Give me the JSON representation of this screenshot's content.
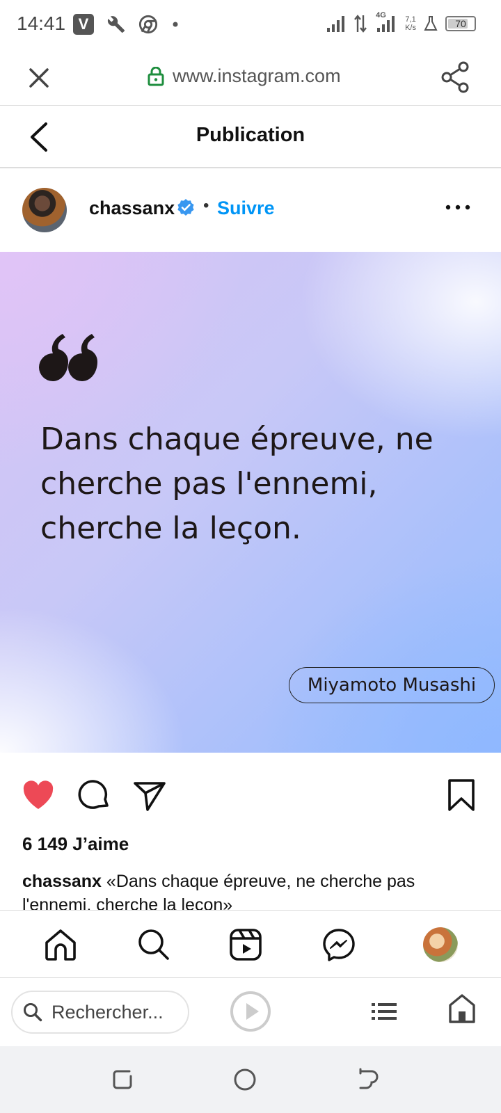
{
  "status_bar": {
    "time": "14:41",
    "network": "4G",
    "speed_value": "7,1",
    "speed_unit": "K/s",
    "battery": "70",
    "icons": [
      "v-app-icon",
      "wrench-icon",
      "chrome-icon",
      "dot-icon",
      "signal-icon",
      "data-arrows-icon",
      "signal-4g-icon",
      "beaker-icon",
      "battery-icon"
    ]
  },
  "browser": {
    "url": "www.instagram.com",
    "search_placeholder": "Rechercher..."
  },
  "header": {
    "title": "Publication"
  },
  "post": {
    "username": "chassanx",
    "follow_label": "Suivre",
    "separator": "•",
    "quote": "Dans chaque épreuve, ne cherche pas l'ennemi, cherche la leçon.",
    "author": "Miyamoto Musashi",
    "likes": "6 149 J’aime",
    "caption_user": "chassanx",
    "caption_text": "«Dans chaque épreuve, ne cherche pas l'ennemi, cherche la leçon»",
    "liked": true
  },
  "colors": {
    "accent": "#0095f6",
    "like": "#ed4956",
    "verified": "#3897f0"
  }
}
